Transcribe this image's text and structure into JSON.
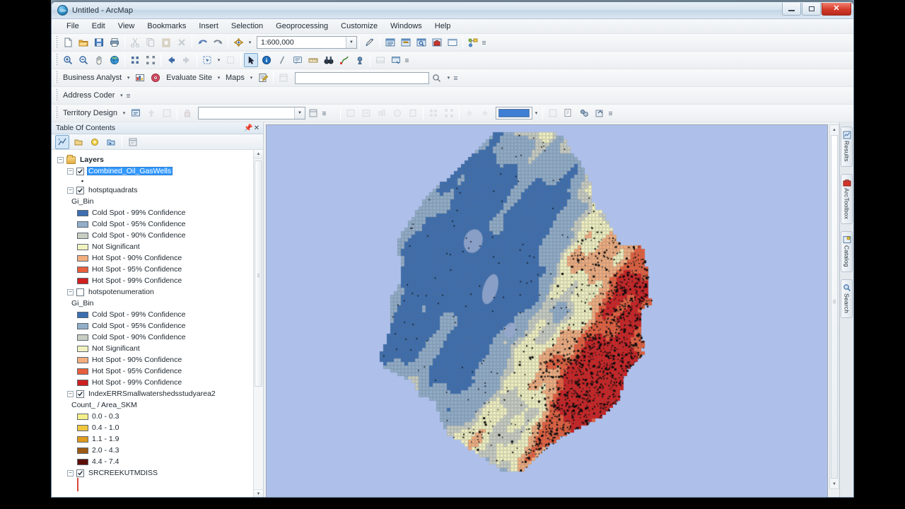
{
  "window": {
    "title": "Untitled - ArcMap",
    "icon": "arcmap-globe-icon",
    "minimize_label": "Minimize",
    "restore_label": "Restore",
    "close_label": "Close"
  },
  "menubar": {
    "items": [
      {
        "label": "File",
        "name": "menu-file"
      },
      {
        "label": "Edit",
        "name": "menu-edit"
      },
      {
        "label": "View",
        "name": "menu-view"
      },
      {
        "label": "Bookmarks",
        "name": "menu-bookmarks"
      },
      {
        "label": "Insert",
        "name": "menu-insert"
      },
      {
        "label": "Selection",
        "name": "menu-selection"
      },
      {
        "label": "Geoprocessing",
        "name": "menu-geoprocessing"
      },
      {
        "label": "Customize",
        "name": "menu-customize"
      },
      {
        "label": "Windows",
        "name": "menu-windows"
      },
      {
        "label": "Help",
        "name": "menu-help"
      }
    ]
  },
  "standard_toolbar": {
    "scale_value": "1:600,000",
    "buttons": [
      {
        "name": "new-map-button",
        "icon": "new-document-icon"
      },
      {
        "name": "open-button",
        "icon": "open-folder-icon"
      },
      {
        "name": "save-button",
        "icon": "save-disk-icon"
      },
      {
        "name": "print-button",
        "icon": "printer-icon"
      },
      {
        "name": "cut-button",
        "icon": "scissors-icon"
      },
      {
        "name": "copy-button",
        "icon": "copy-icon"
      },
      {
        "name": "paste-button",
        "icon": "paste-icon"
      },
      {
        "name": "delete-button",
        "icon": "delete-x-icon"
      },
      {
        "name": "undo-button",
        "icon": "undo-arrow-icon"
      },
      {
        "name": "redo-button",
        "icon": "redo-arrow-icon"
      },
      {
        "name": "add-data-button",
        "icon": "add-data-plus-icon"
      },
      {
        "name": "editor-toolbar-button",
        "icon": "editor-pencil-icon"
      },
      {
        "name": "table-of-contents-button",
        "icon": "toc-window-icon"
      },
      {
        "name": "catalog-window-button",
        "icon": "catalog-window-icon"
      },
      {
        "name": "search-window-button",
        "icon": "search-window-icon"
      },
      {
        "name": "arctoolbox-window-button",
        "icon": "arctoolbox-red-icon"
      },
      {
        "name": "python-window-button",
        "icon": "python-window-icon"
      },
      {
        "name": "model-builder-button",
        "icon": "modelbuilder-icon"
      }
    ]
  },
  "tools_toolbar": {
    "buttons": [
      {
        "name": "zoom-in-button",
        "icon": "magnifier-plus-icon"
      },
      {
        "name": "zoom-out-button",
        "icon": "magnifier-minus-icon"
      },
      {
        "name": "pan-button",
        "icon": "hand-pan-icon"
      },
      {
        "name": "full-extent-button",
        "icon": "globe-full-extent-icon"
      },
      {
        "name": "fixed-zoom-in-button",
        "icon": "zoom-in-corners-icon"
      },
      {
        "name": "fixed-zoom-out-button",
        "icon": "zoom-out-corners-icon"
      },
      {
        "name": "go-back-extent-button",
        "icon": "back-arrow-icon"
      },
      {
        "name": "go-forward-extent-button",
        "icon": "forward-arrow-icon"
      },
      {
        "name": "select-features-button",
        "icon": "select-features-icon"
      },
      {
        "name": "clear-selection-button",
        "icon": "clear-selection-icon"
      },
      {
        "name": "select-elements-button",
        "icon": "cursor-arrow-icon"
      },
      {
        "name": "identify-button",
        "icon": "identify-info-icon"
      },
      {
        "name": "hyperlink-button",
        "icon": "hyperlink-lightning-icon"
      },
      {
        "name": "html-popup-button",
        "icon": "html-popup-icon"
      },
      {
        "name": "measure-button",
        "icon": "measure-ruler-icon"
      },
      {
        "name": "find-button",
        "icon": "binoculars-find-icon"
      },
      {
        "name": "find-route-button",
        "icon": "find-route-icon"
      },
      {
        "name": "go-to-xy-button",
        "icon": "go-to-xy-icon"
      },
      {
        "name": "time-slider-button",
        "icon": "time-slider-icon"
      },
      {
        "name": "create-viewer-button",
        "icon": "create-viewer-icon"
      }
    ]
  },
  "business_analyst_toolbar": {
    "label": "Business Analyst",
    "evaluate_site_label": "Evaluate Site",
    "maps_label": "Maps",
    "search_value": "",
    "buttons": [
      {
        "name": "ba-wizard-button",
        "icon": "ba-wizard-icon"
      },
      {
        "name": "ba-target-button",
        "icon": "ba-target-icon"
      },
      {
        "name": "ba-reports-button",
        "icon": "ba-reports-icon"
      },
      {
        "name": "ba-catalog-button",
        "icon": "ba-catalog-icon"
      }
    ]
  },
  "address_coder_toolbar": {
    "label": "Address Coder"
  },
  "territory_design_toolbar": {
    "label": "Territory Design",
    "dataset_value": "",
    "color_swatch": "#3f7fd4",
    "buttons": [
      {
        "name": "td-new-button",
        "icon": "td-new-icon"
      },
      {
        "name": "td-up-button",
        "icon": "td-up-arrow-icon"
      },
      {
        "name": "td-edit-button",
        "icon": "td-edit-icon"
      },
      {
        "name": "td-lock-button",
        "icon": "td-lock-icon"
      },
      {
        "name": "td-tool-1-button",
        "icon": "td-tool1-icon"
      },
      {
        "name": "td-tool-2-button",
        "icon": "td-tool2-icon"
      },
      {
        "name": "td-tool-3-button",
        "icon": "td-tool3-icon"
      },
      {
        "name": "td-tool-4-button",
        "icon": "td-tool4-icon"
      },
      {
        "name": "td-tool-5-button",
        "icon": "td-tool5-icon"
      },
      {
        "name": "td-align-1-button",
        "icon": "td-align1-icon"
      },
      {
        "name": "td-align-2-button",
        "icon": "td-align2-icon"
      },
      {
        "name": "td-star-1-button",
        "icon": "td-star1-icon"
      },
      {
        "name": "td-star-2-button",
        "icon": "td-star2-icon"
      },
      {
        "name": "td-print-button",
        "icon": "td-print-icon"
      },
      {
        "name": "td-copy-button",
        "icon": "td-copy-icon"
      },
      {
        "name": "td-export-button",
        "icon": "td-export-icon"
      },
      {
        "name": "td-share-button",
        "icon": "td-share-icon"
      }
    ]
  },
  "table_of_contents": {
    "title": "Table Of Contents",
    "pin_icon": "pin-icon",
    "close_icon": "close-icon",
    "tool_buttons": [
      {
        "name": "list-by-drawing-order-button",
        "icon": "list-by-drawing-order-icon",
        "active": true
      },
      {
        "name": "list-by-source-button",
        "icon": "list-by-source-icon",
        "active": false
      },
      {
        "name": "list-by-visibility-button",
        "icon": "list-by-visibility-icon",
        "active": false
      },
      {
        "name": "list-by-selection-button",
        "icon": "list-by-selection-icon",
        "active": false
      },
      {
        "name": "toc-options-button",
        "icon": "toc-options-icon",
        "active": false
      }
    ],
    "root": "Layers",
    "layers": [
      {
        "name": "Combined_Oil_GasWells",
        "checked": true,
        "selected": true,
        "type": "point",
        "symbol_color": "#111111"
      },
      {
        "name": "hotsptquadrats",
        "checked": true,
        "selected": false,
        "field": "Gi_Bin",
        "legend": [
          {
            "label": "Cold Spot - 99% Confidence",
            "color": "#3d6fb0"
          },
          {
            "label": "Cold Spot - 95% Confidence",
            "color": "#93aec9"
          },
          {
            "label": "Cold Spot - 90% Confidence",
            "color": "#c9cec2"
          },
          {
            "label": "Not Significant",
            "color": "#f2f2c0"
          },
          {
            "label": "Hot Spot - 90% Confidence",
            "color": "#f3ae7e"
          },
          {
            "label": "Hot Spot - 95% Confidence",
            "color": "#e85f3c"
          },
          {
            "label": "Hot Spot - 99% Confidence",
            "color": "#cf1f1f"
          }
        ]
      },
      {
        "name": "hotspotenumeration",
        "checked": false,
        "selected": false,
        "field": "Gi_Bin",
        "legend": [
          {
            "label": "Cold Spot - 99% Confidence",
            "color": "#3d6fb0"
          },
          {
            "label": "Cold Spot - 95% Confidence",
            "color": "#93aec9"
          },
          {
            "label": "Cold Spot - 90% Confidence",
            "color": "#c9cec2"
          },
          {
            "label": "Not Significant",
            "color": "#f2f2c0"
          },
          {
            "label": "Hot Spot - 90% Confidence",
            "color": "#f3ae7e"
          },
          {
            "label": "Hot Spot - 95% Confidence",
            "color": "#e85f3c"
          },
          {
            "label": "Hot Spot - 99% Confidence",
            "color": "#cf1f1f"
          }
        ]
      },
      {
        "name": "IndexERRSmallwatershedsstudyarea2",
        "checked": true,
        "selected": false,
        "field": "Count_ / Area_SKM",
        "legend": [
          {
            "label": "0.0 - 0.3",
            "color": "#f5f08a"
          },
          {
            "label": "0.4 - 1.0",
            "color": "#f0c63f"
          },
          {
            "label": "1.1 - 1.9",
            "color": "#e09a1e"
          },
          {
            "label": "2.0 - 4.3",
            "color": "#9c5a14"
          },
          {
            "label": "4.4 - 7.4",
            "color": "#5e0f0a"
          }
        ]
      },
      {
        "name": "SRCREEKUTMDISS",
        "checked": true,
        "selected": false,
        "type": "polygon",
        "symbol_color": "#d94a3d"
      }
    ]
  },
  "map_view": {
    "background_color": "#aec0ea",
    "bottom_buttons": [
      {
        "name": "data-view-button",
        "icon": "data-view-icon",
        "active": true
      },
      {
        "name": "layout-view-button",
        "icon": "layout-view-icon",
        "active": false
      },
      {
        "name": "refresh-view-button",
        "icon": "refresh-icon",
        "active": false
      },
      {
        "name": "pause-drawing-button",
        "icon": "pause-icon",
        "active": false
      },
      {
        "name": "reference-scale-button",
        "icon": "reference-scale-icon",
        "active": false
      }
    ]
  },
  "dock_tabs": [
    {
      "label": "Results",
      "name": "dock-tab-results",
      "icon": "results-icon"
    },
    {
      "label": "ArcToolbox",
      "name": "dock-tab-arctoolbox",
      "icon": "arctoolbox-icon"
    },
    {
      "label": "Catalog",
      "name": "dock-tab-catalog",
      "icon": "catalog-icon"
    },
    {
      "label": "Search",
      "name": "dock-tab-search",
      "icon": "search-icon"
    }
  ],
  "statusbar": {
    "coordinates": ""
  }
}
